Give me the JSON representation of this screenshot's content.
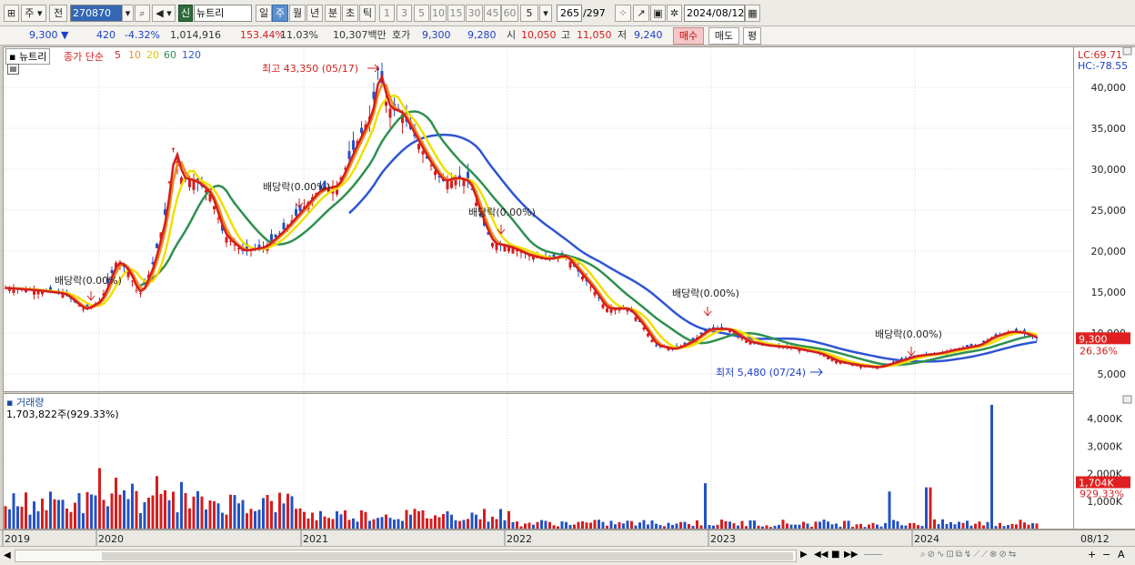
{
  "toolbar": {
    "type_btn": "주",
    "prev_btn": "전",
    "code": "270870",
    "sin_badge": "신",
    "stock_name": "뉴트리",
    "periods": [
      "일",
      "주",
      "월",
      "년",
      "분",
      "초",
      "틱"
    ],
    "selected_period": "주",
    "numbers": [
      "1",
      "3",
      "5",
      "10",
      "15",
      "30",
      "45",
      "60"
    ],
    "count_select": "5",
    "count_current": "265",
    "count_total": "/297",
    "date": "2024/08/12"
  },
  "quote": {
    "price": "9,300",
    "change_arrow": "▼",
    "change": "420",
    "change_pct": "-4.32%",
    "volume": "1,014,916",
    "volume_ratio": "153.44%",
    "turnover": "11.03%",
    "amount": "10,307백만",
    "ask_label": "호가",
    "ask1": "9,300",
    "ask2": "9,280",
    "open_label": "시",
    "open": "10,050",
    "high_label": "고",
    "high": "11,050",
    "low_label": "저",
    "low": "9,240",
    "buy_btn": "매수",
    "sell_btn": "매도",
    "eval_btn": "평"
  },
  "price_pane": {
    "title": "뉴트리",
    "legend": {
      "prefix": "종가 단순",
      "periods": [
        "5",
        "10",
        "20",
        "60",
        "120"
      ],
      "colors": [
        "#d41e1e",
        "#f08c1e",
        "#f0e000",
        "#2f9050",
        "#2f55d4"
      ]
    },
    "lc": "LC:69.71",
    "hc": "HC:-78.55",
    "y_ticks": [
      "40,000",
      "35,000",
      "30,000",
      "25,000",
      "20,000",
      "15,000",
      "10,000",
      "5,000"
    ],
    "current_price_tag": "9,300",
    "current_pct_tag": "26.36%",
    "annotations": {
      "high": "최고 43,350 (05/17)",
      "low": "최저 5,480 (07/24)",
      "div1": "배당락(0.00%)",
      "div2": "배당락(0.00%)",
      "div3": "배당락(0.00%)",
      "div4": "배당락(0.00%)",
      "div5": "배당락(0.00%)"
    }
  },
  "volume_pane": {
    "title": "거래량",
    "subtitle": "1,703,822주(929.33%)",
    "y_ticks": [
      "4,000K",
      "3,000K",
      "2,000K",
      "1,000K"
    ],
    "current_tag": "1,704K",
    "current_pct_tag": "929.33%"
  },
  "x_axis": {
    "labels": [
      "2019",
      "2020",
      "2021",
      "2022",
      "2023",
      "2024"
    ],
    "right_label": "08/12"
  },
  "colors": {
    "up": "#d41e1e",
    "down": "#2452c4",
    "ma5": "#d41e1e",
    "ma10": "#f08c1e",
    "ma20": "#f0e000",
    "ma60": "#2f9050",
    "ma120": "#2f55d4"
  }
}
